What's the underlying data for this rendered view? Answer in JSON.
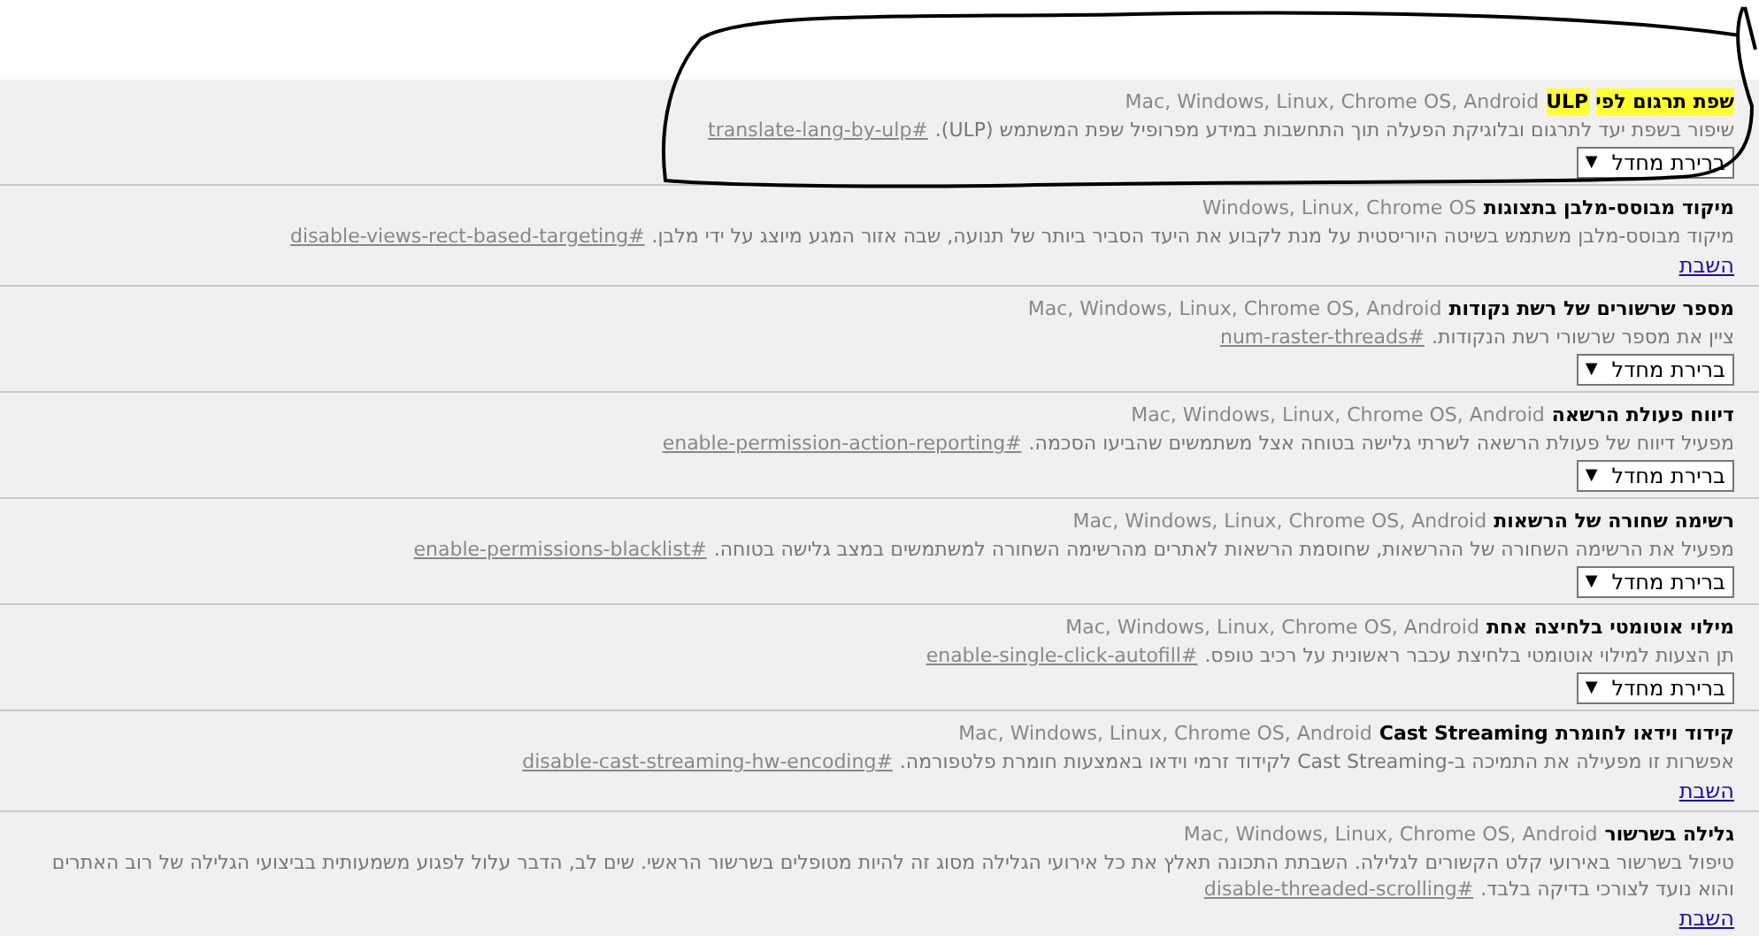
{
  "flags": [
    {
      "title": [
        {
          "text": "שפת תרגום לפי",
          "highlighted": true
        },
        {
          "text": "ULP",
          "highlighted": true
        }
      ],
      "platforms": "Mac, Windows, Linux, Chrome OS, Android",
      "description": "שיפור בשפת יעד לתרגום ובלוגיקת הפעלה תוך התחשבות במידע מפרופיל שפת המשתמש (ULP).",
      "link": "#translate-lang-by-ulp",
      "control": {
        "kind": "select",
        "label": "ברירת מחדל",
        "arrow": "▼"
      }
    },
    {
      "title": [
        {
          "text": "מיקוד מבוסס-מלבן בתצוגות",
          "highlighted": false
        }
      ],
      "platforms": "Windows, Linux, Chrome OS",
      "description": "מיקוד מבוסס-מלבן משתמש בשיטה היוריסטית על מנת לקבוע את היעד הסביר ביותר של תנועה, שבה אזור המגע מיוצג על ידי מלבן.",
      "link": "#disable-views-rect-based-targeting",
      "control": {
        "kind": "link",
        "label": "השבת"
      }
    },
    {
      "title": [
        {
          "text": "מספר שרשורים של רשת נקודות",
          "highlighted": false
        }
      ],
      "platforms": "Mac, Windows, Linux, Chrome OS, Android",
      "description": "ציין את מספר שרשורי רשת הנקודות.",
      "link": "#num-raster-threads",
      "control": {
        "kind": "select",
        "label": "ברירת מחדל",
        "arrow": "▼"
      }
    },
    {
      "title": [
        {
          "text": "דיווח פעולת הרשאה",
          "highlighted": false
        }
      ],
      "platforms": "Mac, Windows, Linux, Chrome OS, Android",
      "description": "מפעיל דיווח של פעולת הרשאה לשרתי גלישה בטוחה אצל משתמשים שהביעו הסכמה.",
      "link": "#enable-permission-action-reporting",
      "control": {
        "kind": "select",
        "label": "ברירת מחדל",
        "arrow": "▼"
      }
    },
    {
      "title": [
        {
          "text": "רשימה שחורה של הרשאות",
          "highlighted": false
        }
      ],
      "platforms": "Mac, Windows, Linux, Chrome OS, Android",
      "description": "מפעיל את הרשימה השחורה של ההרשאות, שחוסמת הרשאות לאתרים מהרשימה השחורה למשתמשים במצב גלישה בטוחה.",
      "link": "#enable-permissions-blacklist",
      "control": {
        "kind": "select",
        "label": "ברירת מחדל",
        "arrow": "▼"
      }
    },
    {
      "title": [
        {
          "text": "מילוי אוטומטי בלחיצה אחת",
          "highlighted": false
        }
      ],
      "platforms": "Mac, Windows, Linux, Chrome OS, Android",
      "description": "תן הצעות למילוי אוטומטי בלחיצת עכבר ראשונית על רכיב טופס.",
      "link": "#enable-single-click-autofill",
      "control": {
        "kind": "select",
        "label": "ברירת מחדל",
        "arrow": "▼"
      }
    },
    {
      "title": [
        {
          "text": "קידוד וידאו לחומרת",
          "highlighted": false
        },
        {
          "text": "Cast Streaming",
          "highlighted": false
        }
      ],
      "platforms": "Mac, Windows, Linux, Chrome OS, Android",
      "description": "אפשרות זו מפעילה את התמיכה ב-Cast Streaming לקידוד זרמי וידאו באמצעות חומרת פלטפורמה.",
      "link": "#disable-cast-streaming-hw-encoding",
      "control": {
        "kind": "link",
        "label": "השבת"
      }
    },
    {
      "title": [
        {
          "text": "גלילה בשרשור",
          "highlighted": false
        }
      ],
      "platforms": "Mac, Windows, Linux, Chrome OS, Android",
      "description": "טיפול בשרשור באירועי קלט הקשורים לגלילה. השבתת התכונה תאלץ את כל אירועי הגלילה מסוג זה להיות מטופלים בשרשור הראשי. שים לב, הדבר עלול לפגוע משמעותית בביצועי הגלילה של רוב האתרים והוא נועד לצורכי בדיקה בלבד.",
      "link": "#disable-threaded-scrolling",
      "control": {
        "kind": "link",
        "label": "השבת"
      }
    }
  ]
}
